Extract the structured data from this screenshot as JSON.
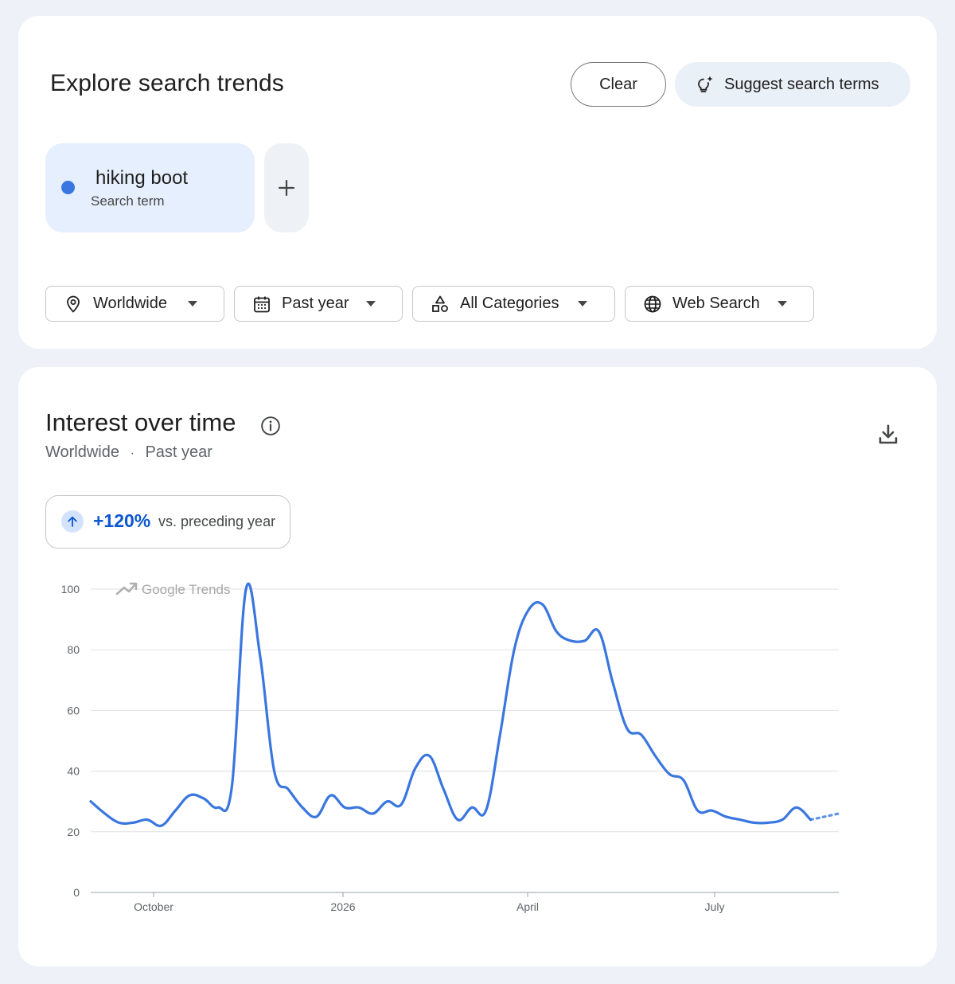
{
  "explore": {
    "title": "Explore search trends",
    "clear_label": "Clear",
    "suggest_label": "Suggest search terms",
    "term": {
      "name": "hiking boot",
      "type": "Search term",
      "color": "#3a76df"
    },
    "add_label": "+",
    "filters": [
      {
        "label": "Worldwide",
        "icon": "location-pin-icon"
      },
      {
        "label": "Past year",
        "icon": "calendar-icon"
      },
      {
        "label": "All Categories",
        "icon": "categories-icon"
      },
      {
        "label": "Web Search",
        "icon": "globe-icon"
      }
    ]
  },
  "interest": {
    "title": "Interest over time",
    "subtitle_region": "Worldwide",
    "subtitle_sep": "·",
    "subtitle_period": "Past year",
    "change_value": "+120%",
    "change_text": "vs. preceding year",
    "watermark": "Google Trends"
  },
  "colors": {
    "accent": "#0b57d0",
    "series": "#3a76df",
    "grid": "#e0e0e0"
  },
  "chart_data": {
    "type": "line",
    "x_tick_labels": [
      "October",
      "2026",
      "April",
      "July"
    ],
    "y_tick_labels": [
      "0",
      "20",
      "40",
      "60",
      "80",
      "100"
    ],
    "ylim": [
      0,
      100
    ],
    "grid": true,
    "series": [
      {
        "values": [
          30,
          26,
          23,
          23,
          24,
          22,
          27,
          32,
          31,
          28,
          35,
          100,
          78,
          40,
          34,
          28,
          25,
          32,
          28,
          28,
          26,
          30,
          29,
          41,
          45,
          34,
          24,
          28,
          27,
          52,
          80,
          93,
          95,
          86,
          83,
          83,
          86,
          69,
          54,
          52,
          45,
          39,
          37,
          27,
          27,
          25,
          24,
          23,
          23,
          24,
          28,
          24
        ],
        "partial_values": [
          24,
          25,
          26
        ]
      }
    ]
  }
}
